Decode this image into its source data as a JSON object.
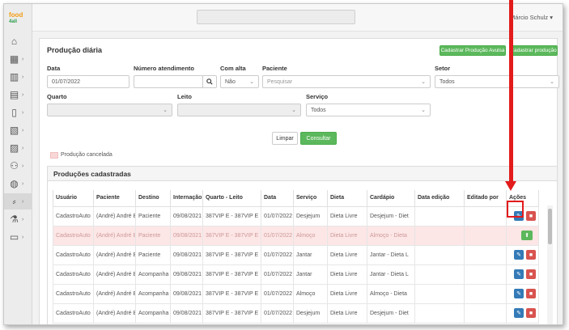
{
  "logo": {
    "line1": "food",
    "line2": "4all"
  },
  "sidebar": {
    "items": [
      {
        "icon": "home-icon",
        "glyph": "⌂"
      },
      {
        "icon": "grid-icon",
        "glyph": "▦"
      },
      {
        "icon": "building-icon",
        "glyph": "▥"
      },
      {
        "icon": "calendar-icon",
        "glyph": "▤"
      },
      {
        "icon": "clipboard-icon",
        "glyph": "▯"
      },
      {
        "icon": "cart-icon",
        "glyph": "▧"
      },
      {
        "icon": "box-icon",
        "glyph": "▨"
      },
      {
        "icon": "people-icon",
        "glyph": "⚇"
      },
      {
        "icon": "dish-icon",
        "glyph": "◍"
      },
      {
        "icon": "utensils-icon",
        "glyph": "⸗"
      },
      {
        "icon": "flask-icon",
        "glyph": "⚗"
      },
      {
        "icon": "truck-icon",
        "glyph": "▭"
      }
    ]
  },
  "header": {
    "user": "Márcio Schulz ▾"
  },
  "page": {
    "title": "Produção diária",
    "btn_avulsa": "Cadastrar Produção Avulsa",
    "btn_producao": "Cadastrar produção"
  },
  "filters": {
    "data_label": "Data",
    "data_value": "01/07/2022",
    "atendimento_label": "Número atendimento",
    "atendimento_value": "",
    "alta_label": "Com alta",
    "alta_value": "Não",
    "paciente_label": "Paciente",
    "paciente_placeholder": "Pesquisar",
    "setor_label": "Setor",
    "setor_value": "Todos",
    "quarto_label": "Quarto",
    "leito_label": "Leito",
    "servico_label": "Serviço",
    "servico_value": "Todos",
    "limpar": "Limpar",
    "consultar": "Consultar",
    "legend": "Produção cancelada"
  },
  "table": {
    "title": "Produções cadastradas",
    "columns": [
      "Usuário",
      "Paciente",
      "Destino",
      "Internação",
      "Quarto - Leito",
      "Data",
      "Serviço",
      "Dieta",
      "Cardápio",
      "Data edição",
      "Editado por",
      "Ações"
    ],
    "rows": [
      {
        "usuario": "CadastroAuto",
        "paciente": "(André) André B",
        "destino": "Paciente",
        "internacao": "09/08/2021",
        "quarto": "387VIP E - 387VIP E",
        "data": "01/07/2022",
        "servico": "Desjejum",
        "dieta": "Dieta Livre",
        "cardapio": "Desjejum - Diet",
        "cancelled": false
      },
      {
        "usuario": "CadastroAuto",
        "paciente": "(André) André B",
        "destino": "Paciente",
        "internacao": "09/08/2021",
        "quarto": "387VIP E - 387VIP E",
        "data": "01/07/2022",
        "servico": "Almoço",
        "dieta": "Dieta Livre",
        "cardapio": "Almoço - Dieta",
        "cancelled": true
      },
      {
        "usuario": "CadastroAuto",
        "paciente": "(André) André B",
        "destino": "Paciente",
        "internacao": "09/08/2021",
        "quarto": "387VIP E - 387VIP E",
        "data": "01/07/2022",
        "servico": "Jantar",
        "dieta": "Dieta Livre",
        "cardapio": "Jantar - Dieta L",
        "cancelled": false
      },
      {
        "usuario": "CadastroAuto",
        "paciente": "(André) André B",
        "destino": "Acompanha",
        "internacao": "09/08/2021",
        "quarto": "387VIP E - 387VIP E",
        "data": "01/07/2022",
        "servico": "Jantar",
        "dieta": "Dieta Livre",
        "cardapio": "Jantar - Dieta L",
        "cancelled": false
      },
      {
        "usuario": "CadastroAuto",
        "paciente": "(André) André B",
        "destino": "Acompanha",
        "internacao": "09/08/2021",
        "quarto": "387VIP E - 387VIP E",
        "data": "01/07/2022",
        "servico": "Almoço",
        "dieta": "Dieta Livre",
        "cardapio": "Almoço - Dieta",
        "cancelled": false
      },
      {
        "usuario": "CadastroAuto",
        "paciente": "(André) André B",
        "destino": "Acompanha",
        "internacao": "09/08/2021",
        "quarto": "387VIP E - 387VIP E",
        "data": "01/07/2022",
        "servico": "Desjejum",
        "dieta": "Dieta Livre",
        "cardapio": "Desjejum - Diet",
        "cancelled": false
      }
    ]
  },
  "colors": {
    "accent_green": "#5cb85c",
    "edit_blue": "#337ab7",
    "delete_red": "#d9534f",
    "annotation_red": "#e31b1b"
  }
}
